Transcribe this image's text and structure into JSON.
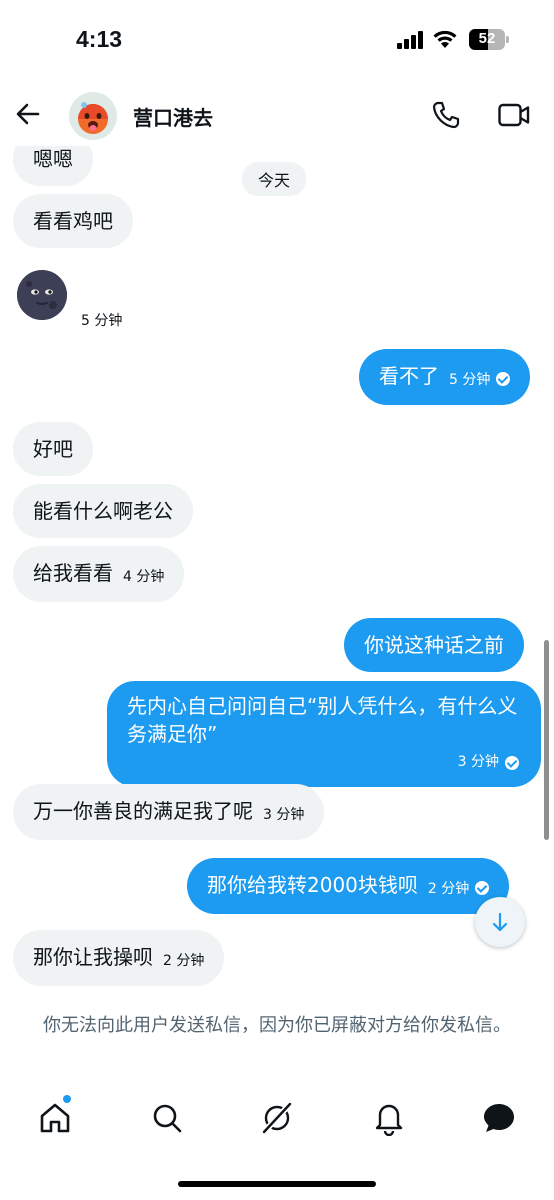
{
  "status_bar": {
    "time": "4:13",
    "battery": "52"
  },
  "header": {
    "contact_name": "营口港去"
  },
  "day_separator": "今天",
  "messages": [
    {
      "dir": "in",
      "text": "嗯嗯"
    },
    {
      "dir": "in",
      "text": "看看鸡吧"
    },
    {
      "dir": "in",
      "text": "🌚",
      "time": "5 分钟"
    },
    {
      "dir": "out",
      "text": "看不了",
      "time": "5 分钟"
    },
    {
      "dir": "in",
      "text": "好吧"
    },
    {
      "dir": "in",
      "text": "能看什么啊老公"
    },
    {
      "dir": "in",
      "text": "给我看看",
      "time": "4 分钟"
    },
    {
      "dir": "out",
      "text": "你说这种话之前"
    },
    {
      "dir": "out",
      "text": "先内心自己问问自己“别人凭什么，有什么义务满足你”",
      "time": "3 分钟"
    },
    {
      "dir": "in",
      "text": "万一你善良的满足我了呢",
      "time": "3 分钟"
    },
    {
      "dir": "out",
      "text": "那你给我转2000块钱呗",
      "time": "2 分钟"
    },
    {
      "dir": "in",
      "text": "那你让我操呗",
      "time": "2 分钟"
    }
  ],
  "blocked_note": "你无法向此用户发送私信，因为你已屏蔽对方给你发私信。",
  "nav": {
    "items": [
      "home-icon",
      "search-icon",
      "grok-icon",
      "notifications-icon",
      "messages-icon"
    ]
  },
  "colors": {
    "accent": "#1d9bf0",
    "incoming_bubble": "#eff3f4",
    "muted_text": "#536471"
  }
}
